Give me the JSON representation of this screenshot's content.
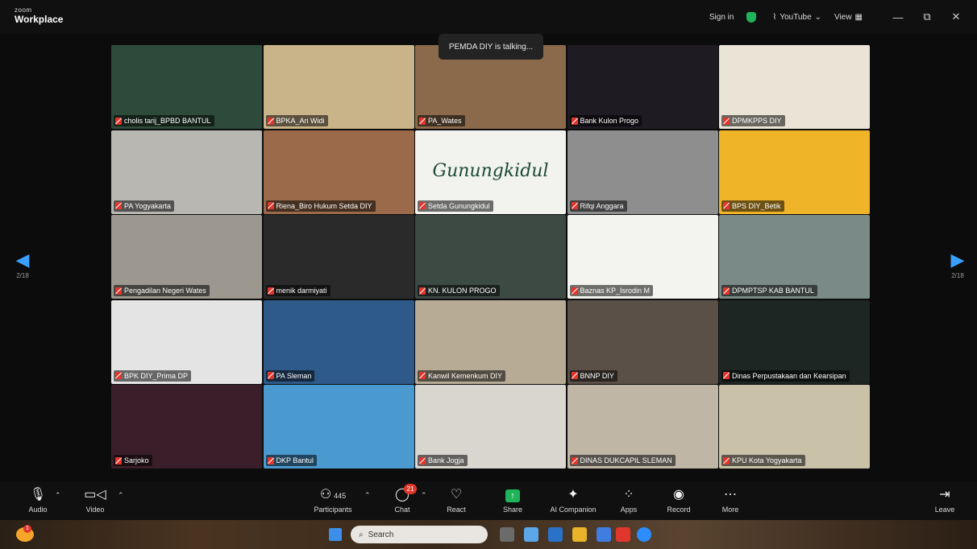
{
  "app": {
    "logo_small": "zoom",
    "logo_large": "Workplace"
  },
  "titlebar": {
    "sign_in": "Sign in",
    "youtube": "YouTube",
    "view": "View",
    "minimize": "—",
    "restore": "⧉",
    "close": "✕"
  },
  "talking_indicator": "PEMDA DIY is talking...",
  "pager": {
    "prev_page": "2/18",
    "next_page": "2/18"
  },
  "tiles": [
    {
      "name": "cholis tarij_BPBD BANTUL",
      "bg": "#2d4a3a"
    },
    {
      "name": "BPKA_Ari Widi",
      "bg": "#c9b48a"
    },
    {
      "name": "PA_Wates",
      "bg": "#8a6a4a"
    },
    {
      "name": "Bank Kulon Progo",
      "bg": "#1f1b22"
    },
    {
      "name": "DPMKPPS DIY",
      "bg": "#e9e4d6"
    },
    {
      "name": "PA Yogyakarta",
      "bg": "#b8b7b2"
    },
    {
      "name": "Riena_Biro Hukum Setda DIY",
      "bg": "#9a6a4a"
    },
    {
      "name": "Setda Gunungkidul",
      "bg": "#f2f2ee",
      "center_text": "Gunungkidul"
    },
    {
      "name": "Rifqi Anggara",
      "bg": "#8e8e8e"
    },
    {
      "name": "BPS DIY_Betik",
      "bg": "#f0b429"
    },
    {
      "name": "Pengadilan Negeri Wates",
      "bg": "#9c9890"
    },
    {
      "name": "menik darmiyati",
      "bg": "#2a2a2a"
    },
    {
      "name": "KN. KULON PROGO",
      "bg": "#3d4a44"
    },
    {
      "name": "Baznas KP_Isrodin M",
      "bg": "#f3f3ef"
    },
    {
      "name": "DPMPTSP KAB BANTUL",
      "bg": "#7a8a86"
    },
    {
      "name": "BPK DIY_Prima DP",
      "bg": "#e4e4e4"
    },
    {
      "name": "PA Sleman",
      "bg": "#2e5a8a"
    },
    {
      "name": "Kanwil Kemenkum DIY",
      "bg": "#b7ab95"
    },
    {
      "name": "BNNP DIY",
      "bg": "#5b5048"
    },
    {
      "name": "Dinas Perpustakaan dan Kearsipan",
      "bg": "#1e2624"
    },
    {
      "name": "Sarjoko",
      "bg": "#3a1f2a"
    },
    {
      "name": "DKP Bantul",
      "bg": "#4a9ad0"
    },
    {
      "name": "Bank Jogja",
      "bg": "#d9d6d0"
    },
    {
      "name": "DINAS DUKCAPIL SLEMAN",
      "bg": "#bfb6a6"
    },
    {
      "name": "KPU Kota Yogyakarta",
      "bg": "#c9c1a8"
    }
  ],
  "toolbar": {
    "audio": "Audio",
    "video": "Video",
    "participants": "Participants",
    "participants_count": "445",
    "chat": "Chat",
    "chat_badge": "21",
    "react": "React",
    "share": "Share",
    "ai_companion": "AI Companion",
    "apps": "Apps",
    "record": "Record",
    "more": "More",
    "leave": "Leave"
  },
  "taskbar": {
    "search_placeholder": "Search",
    "weather_badge": "1"
  },
  "colors": {
    "accent_blue": "#3aa0ff",
    "share_green": "#1fb35a",
    "alert_red": "#e0362c"
  }
}
